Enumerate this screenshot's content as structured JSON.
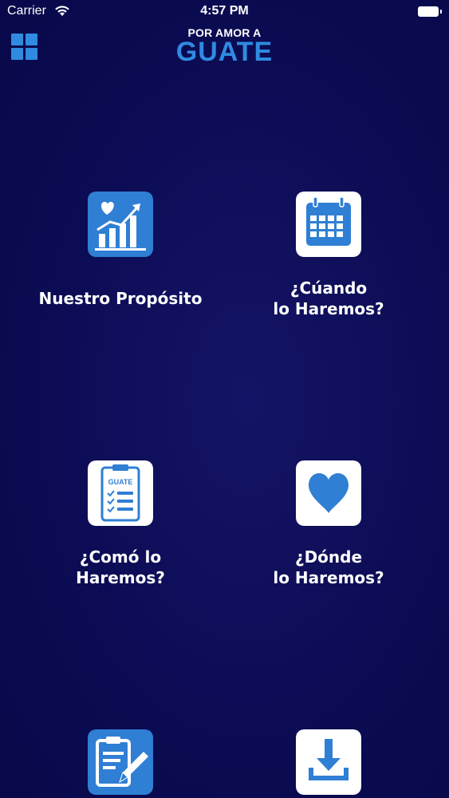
{
  "status_bar": {
    "carrier": "Carrier",
    "time": "4:57 PM"
  },
  "header": {
    "logo_top": "POR AMOR A",
    "logo_main": "GUATE",
    "menu_icon": "grid-icon"
  },
  "colors": {
    "background": "#0c0c55",
    "accent": "#2f8be0",
    "white": "#ffffff"
  },
  "tiles": [
    {
      "id": "proposito",
      "icon": "heart-chart-icon",
      "label_lines": [
        "Nuestro Propósito"
      ]
    },
    {
      "id": "cuando",
      "icon": "calendar-icon",
      "label_lines": [
        "¿Cúando",
        "lo Haremos?"
      ]
    },
    {
      "id": "como",
      "icon": "clipboard-checklist-icon",
      "icon_text": "GUATE",
      "label_lines": [
        "¿Comó lo",
        "Haremos?"
      ]
    },
    {
      "id": "donde",
      "icon": "heart-icon",
      "label_lines": [
        "¿Dónde",
        "lo Haremos?"
      ]
    },
    {
      "id": "registro",
      "icon": "clipboard-pencil-icon",
      "label_lines": []
    },
    {
      "id": "descargar",
      "icon": "download-icon",
      "label_lines": []
    }
  ]
}
